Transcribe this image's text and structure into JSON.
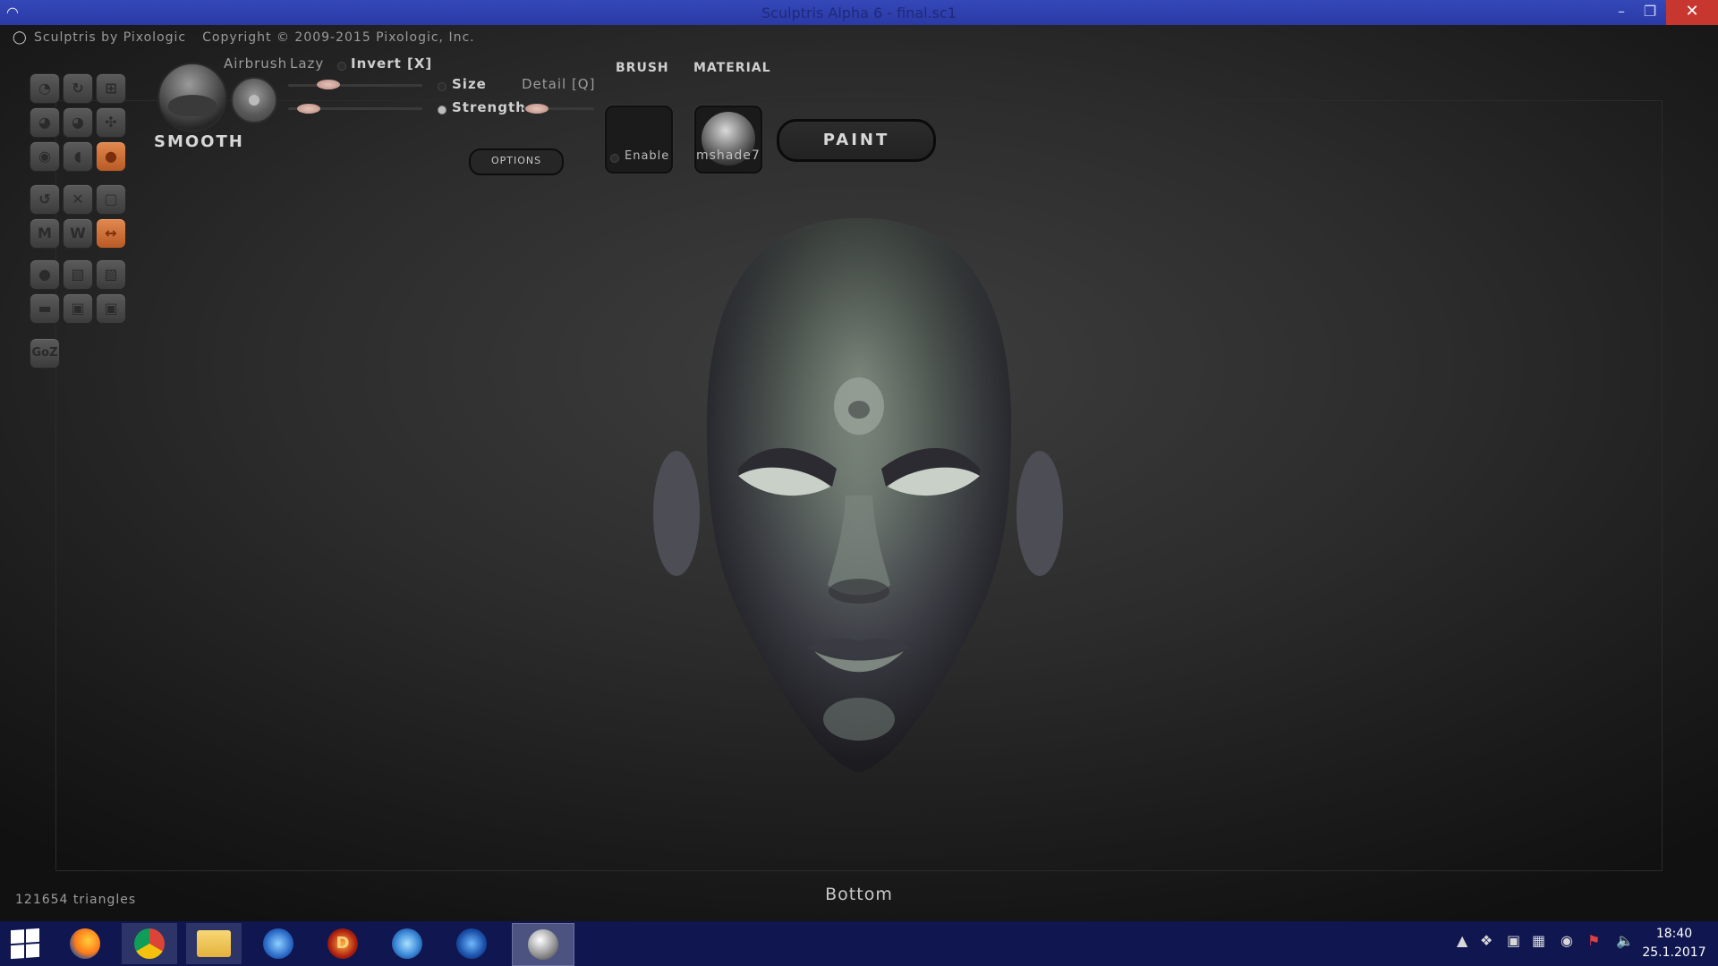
{
  "window": {
    "title": "Sculptris Alpha 6 - final.sc1",
    "minimize": "–",
    "maximize": "❐",
    "close": "✕"
  },
  "infobar": {
    "app_name": "Sculptris by Pixologic",
    "copyright": "Copyright © 2009-2015 Pixologic, Inc."
  },
  "brush": {
    "name": "SMOOTH",
    "airbrush_label": "Airbrush",
    "lazy_label": "Lazy",
    "invert_label": "Invert [X]",
    "size_label": "Size",
    "strength_label": "Strength",
    "detail_label": "Detail [Q]",
    "options_label": "OPTIONS",
    "brush_header": "BRUSH",
    "enable_label": "Enable",
    "material_header": "MATERIAL",
    "material_name": "mshade7"
  },
  "sliders": {
    "lazy": 0.3,
    "size": 0.15,
    "detail": 0.2
  },
  "mode_button": "PAINT",
  "toolbar": {
    "goz_label": "GoZ",
    "accent_color": "#d0743a"
  },
  "status": {
    "triangles": "121654 triangles",
    "view_name": "Bottom"
  },
  "taskbar": {
    "time": "18:40",
    "date": "25.1.2017"
  }
}
